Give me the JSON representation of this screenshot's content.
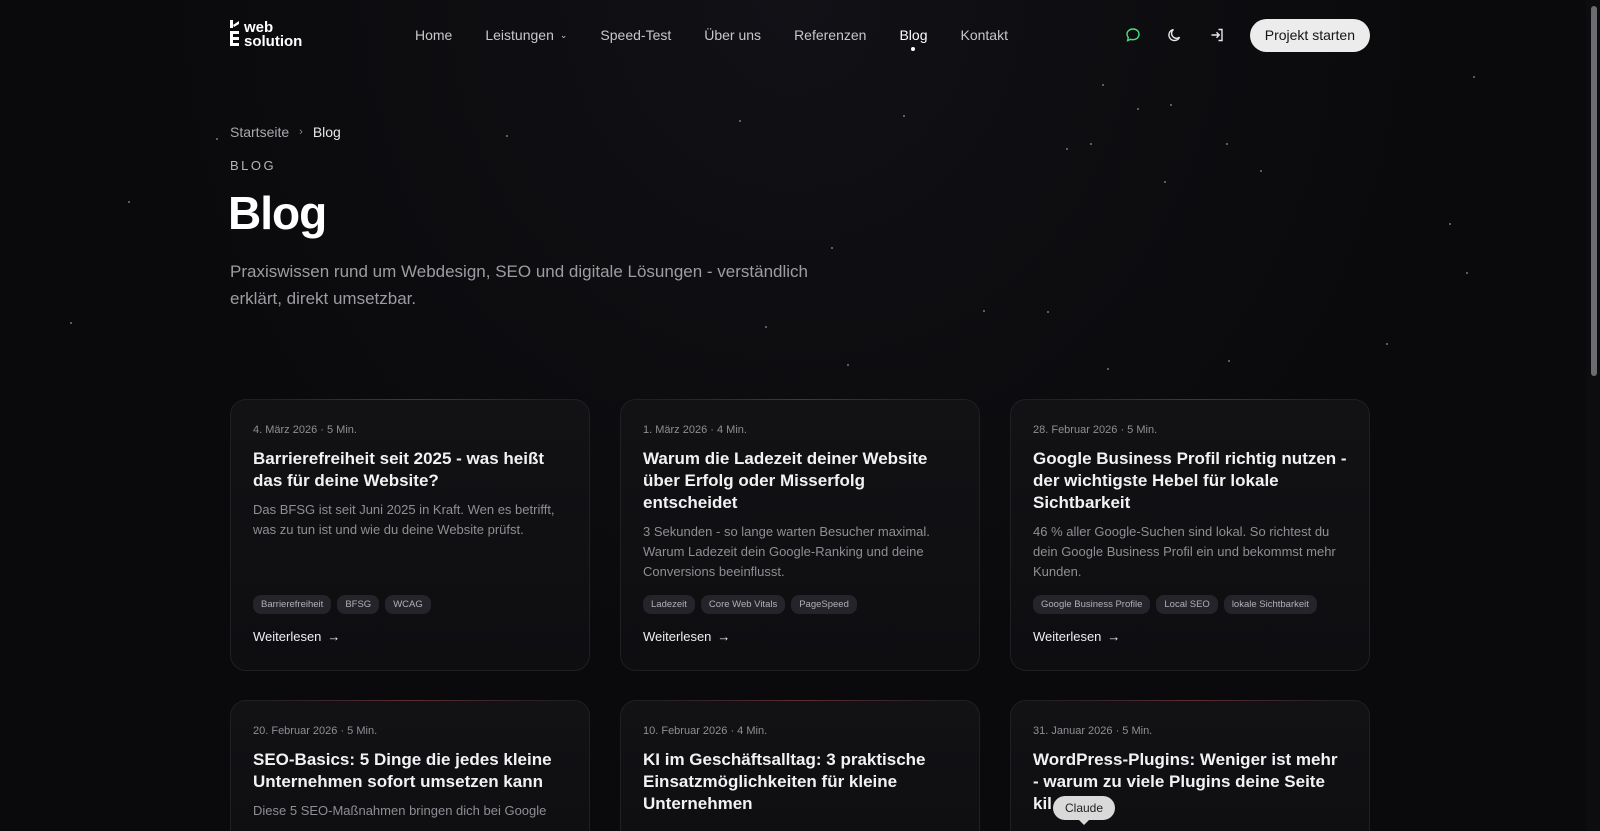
{
  "brand": {
    "logo_mark": "E",
    "logo_line1": "web",
    "logo_line2": "solution"
  },
  "nav": {
    "items": [
      {
        "label": "Home"
      },
      {
        "label": "Leistungen"
      },
      {
        "label": "Speed-Test"
      },
      {
        "label": "Über uns"
      },
      {
        "label": "Referenzen"
      },
      {
        "label": "Blog"
      },
      {
        "label": "Kontakt"
      }
    ],
    "active": "Blog"
  },
  "actions": {
    "cta_label": "Projekt starten",
    "accent_color": "#4ade80"
  },
  "breadcrumb": {
    "home": "Startseite",
    "current": "Blog"
  },
  "hero": {
    "eyebrow": "BLOG",
    "title": "Blog",
    "lead": "Praxiswissen rund um Webdesign, SEO und digitale Lösungen - verständlich erklärt, direkt umsetzbar."
  },
  "posts": [
    {
      "meta": "4. März 2026 · 5 Min.",
      "title": "Barrierefreiheit seit 2025 - was heißt das für deine Website?",
      "desc": "Das BFSG ist seit Juni 2025 in Kraft. Wen es betrifft, was zu tun ist und wie du deine Website prüfst.",
      "tags": [
        "Barrierefreiheit",
        "BFSG",
        "WCAG"
      ],
      "cta": "Weiterlesen"
    },
    {
      "meta": "1. März 2026 · 4 Min.",
      "title": "Warum die Ladezeit deiner Website über Erfolg oder Misserfolg entscheidet",
      "desc": "3 Sekunden - so lange warten Besucher maximal. Warum Ladezeit dein Google-Ranking und deine Conversions beeinflusst.",
      "tags": [
        "Ladezeit",
        "Core Web Vitals",
        "PageSpeed"
      ],
      "cta": "Weiterlesen"
    },
    {
      "meta": "28. Februar 2026 · 5 Min.",
      "title": "Google Business Profil richtig nutzen - der wichtigste Hebel für lokale Sichtbarkeit",
      "desc": "46 % aller Google-Suchen sind lokal. So richtest du dein Google Business Profil ein und bekommst mehr Kunden.",
      "tags": [
        "Google Business Profile",
        "Local SEO",
        "lokale Sichtbarkeit"
      ],
      "cta": "Weiterlesen"
    },
    {
      "meta": "20. Februar 2026 · 5 Min.",
      "title": "SEO-Basics: 5 Dinge die jedes kleine Unternehmen sofort umsetzen kann",
      "desc": "Diese 5 SEO-Maßnahmen bringen dich bei Google",
      "tags": [],
      "cta": ""
    },
    {
      "meta": "10. Februar 2026 · 4 Min.",
      "title": "KI im Geschäftsalltag: 3 praktische Einsatzmöglichkeiten für kleine Unternehmen",
      "desc": "",
      "tags": [],
      "cta": ""
    },
    {
      "meta": "31. Januar 2026 · 5 Min.",
      "title": "WordPress-Plugins: Weniger ist mehr - warum zu viele Plugins deine Seite kil",
      "desc": "",
      "tags": [],
      "cta": ""
    }
  ],
  "tooltip": {
    "label": "Claude"
  }
}
